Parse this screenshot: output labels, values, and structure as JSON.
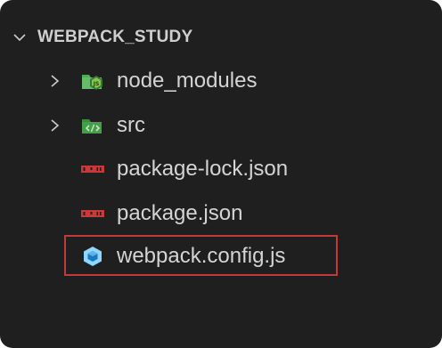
{
  "explorer": {
    "folder_title": "WEBPACK_STUDY",
    "items": [
      {
        "label": "node_modules",
        "kind": "folder",
        "expanded": false,
        "icon": "node-modules-folder-icon"
      },
      {
        "label": "src",
        "kind": "folder",
        "expanded": false,
        "icon": "src-folder-icon"
      },
      {
        "label": "package-lock.json",
        "kind": "file",
        "icon": "npm-icon"
      },
      {
        "label": "package.json",
        "kind": "file",
        "icon": "npm-icon"
      },
      {
        "label": "webpack.config.js",
        "kind": "file",
        "icon": "webpack-icon",
        "highlighted": true
      }
    ]
  },
  "colors": {
    "background": "#1f1f1f",
    "text": "#d4d4d4",
    "highlight_border": "#c0393b",
    "folder_green": "#4caf50",
    "npm_red": "#cb3837",
    "webpack_blue": "#8ed6fb"
  }
}
